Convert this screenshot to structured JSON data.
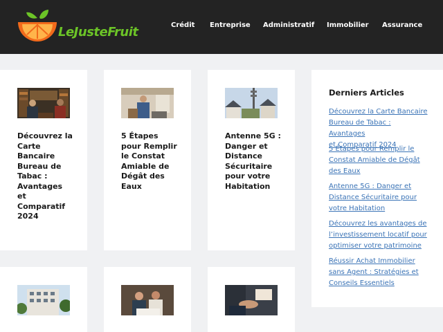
{
  "site": {
    "logo_text": "LeJusteFruit",
    "accent_green": "#6cc427",
    "accent_orange": "#f26a1b",
    "header_bg": "#232323"
  },
  "nav": {
    "items": [
      "Crédit",
      "Entreprise",
      "Administratif",
      "Immobilier",
      "Assurance"
    ]
  },
  "articles": [
    {
      "title": "Découvrez la Carte Bancaire Bureau de Tabac : Avantages et Comparatif 2024",
      "lines": [
        "Découvrez la",
        "Carte",
        "Bancaire",
        "Bureau de",
        "Tabac :",
        "Avantages",
        "et",
        "Comparatif",
        "2024"
      ],
      "image": "library-meeting-photo"
    },
    {
      "title": "5 Étapes pour Remplir le Constat Amiable de Dégât des Eaux",
      "lines": [
        "5 Étapes",
        "pour Remplir",
        "le Constat",
        "Amiable de",
        "Dégât des",
        "Eaux"
      ],
      "image": "water-damage-home-photo"
    },
    {
      "title": "Antenne 5G : Danger et Distance Sécuritaire pour votre Habitation",
      "lines": [
        "Antenne 5G :",
        "Danger et",
        "Distance",
        "Sécuritaire",
        "pour votre",
        "Habitation"
      ],
      "image": "antenna-houses-photo"
    },
    {
      "title": "",
      "lines": [],
      "image": "apartment-building-photo"
    },
    {
      "title": "",
      "lines": [],
      "image": "couple-paperwork-photo"
    },
    {
      "title": "",
      "lines": [],
      "image": "handshake-photo"
    }
  ],
  "sidebar": {
    "heading": "Derniers Articles",
    "links": [
      {
        "lines": [
          "Découvrez la Carte Bancaire",
          "Bureau de Tabac : Avantages",
          "et Comparatif 2024"
        ]
      },
      {
        "lines": [
          "5 Étapes pour Remplir le",
          "Constat Amiable de Dégât",
          "des Eaux"
        ]
      },
      {
        "lines": [
          "Antenne 5G : Danger et",
          "Distance Sécuritaire pour",
          "votre Habitation"
        ]
      },
      {
        "lines": [
          "Découvrez les avantages de",
          "l’investissement locatif pour",
          "optimiser votre patrimoine"
        ]
      },
      {
        "lines": [
          "Réussir Achat Immobilier",
          "sans Agent : Stratégies et",
          "Conseils Essentiels"
        ]
      }
    ]
  }
}
